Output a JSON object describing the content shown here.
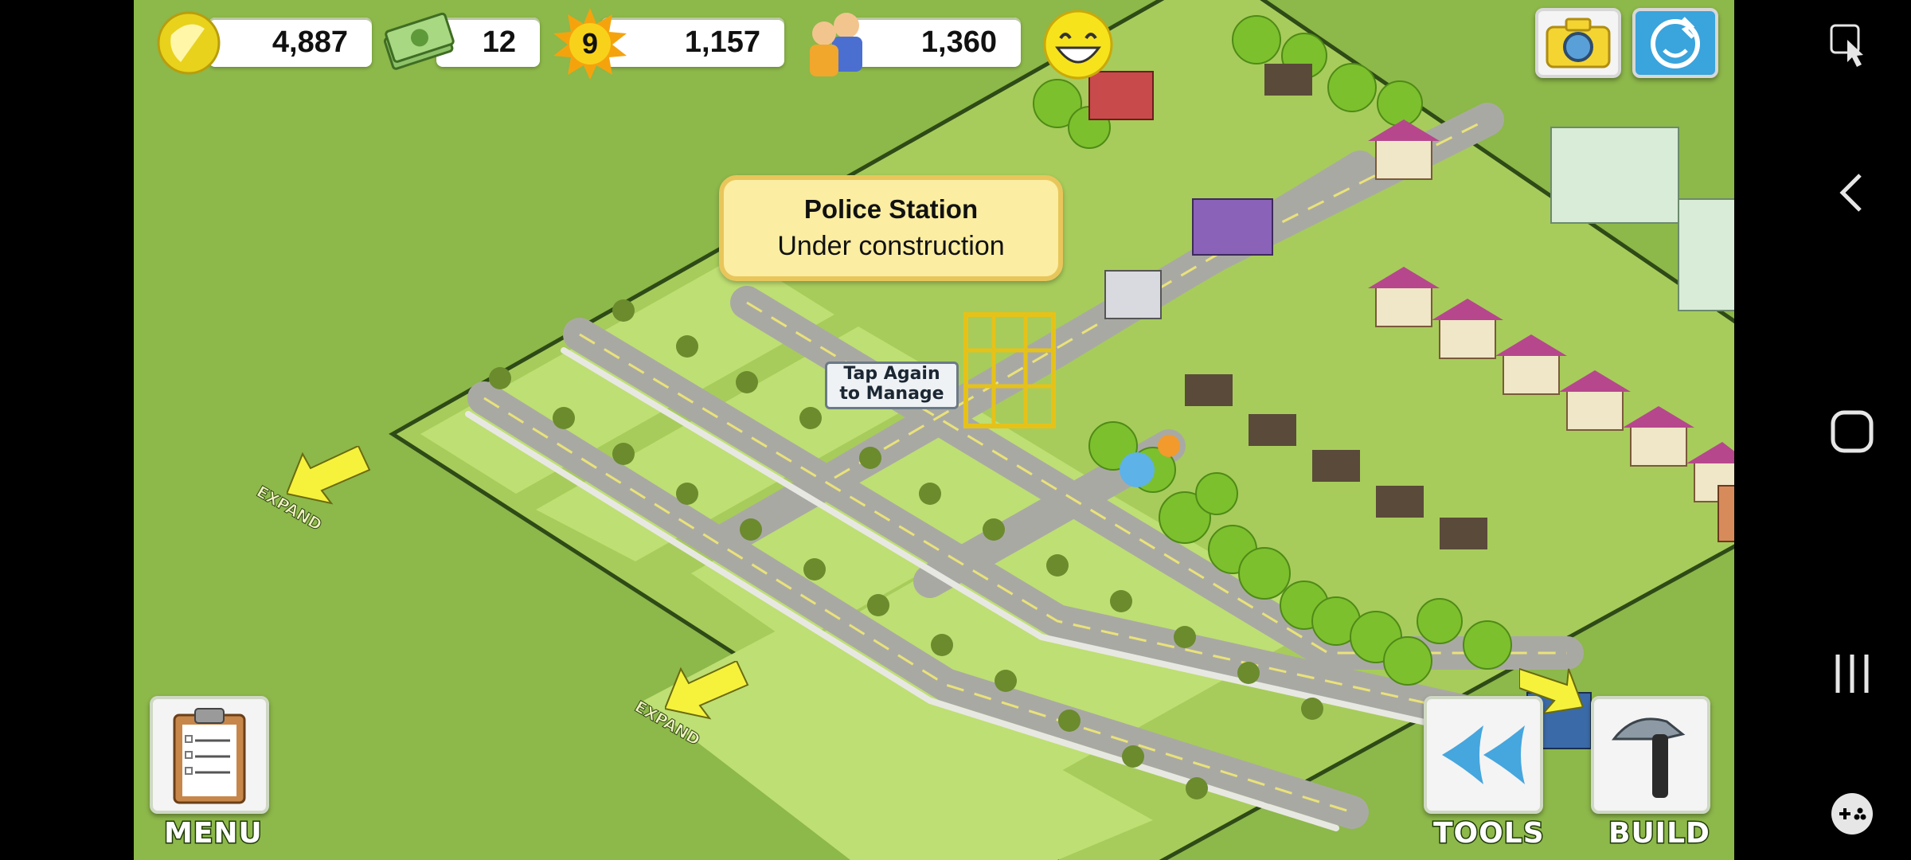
{
  "hud": {
    "coins": "4,887",
    "cash": "12",
    "level": "9",
    "xp": "1,157",
    "population": "1,360"
  },
  "tooltip": {
    "title": "Police Station",
    "subtitle": "Under construction"
  },
  "construction": {
    "label_line1": "Tap Again",
    "label_line2": "to Manage"
  },
  "expand_arrows": [
    {
      "label": "EXPAND"
    },
    {
      "label": "EXPAND"
    }
  ],
  "buttons": {
    "menu": "MENU",
    "tools": "TOOLS",
    "build": "BUILD"
  },
  "colors": {
    "grass": "#8db84a",
    "lawn": "#b7d86d",
    "road": "#9a9a9a",
    "tooltip_bg": "#fbeda1",
    "arrow": "#f4f03a"
  },
  "icons": {
    "top_right": [
      "camera-icon",
      "neighbor-face-icon"
    ],
    "system": [
      "screenshot-touch-icon",
      "back-icon",
      "home-icon",
      "recents-icon",
      "gamepad-icon"
    ]
  }
}
